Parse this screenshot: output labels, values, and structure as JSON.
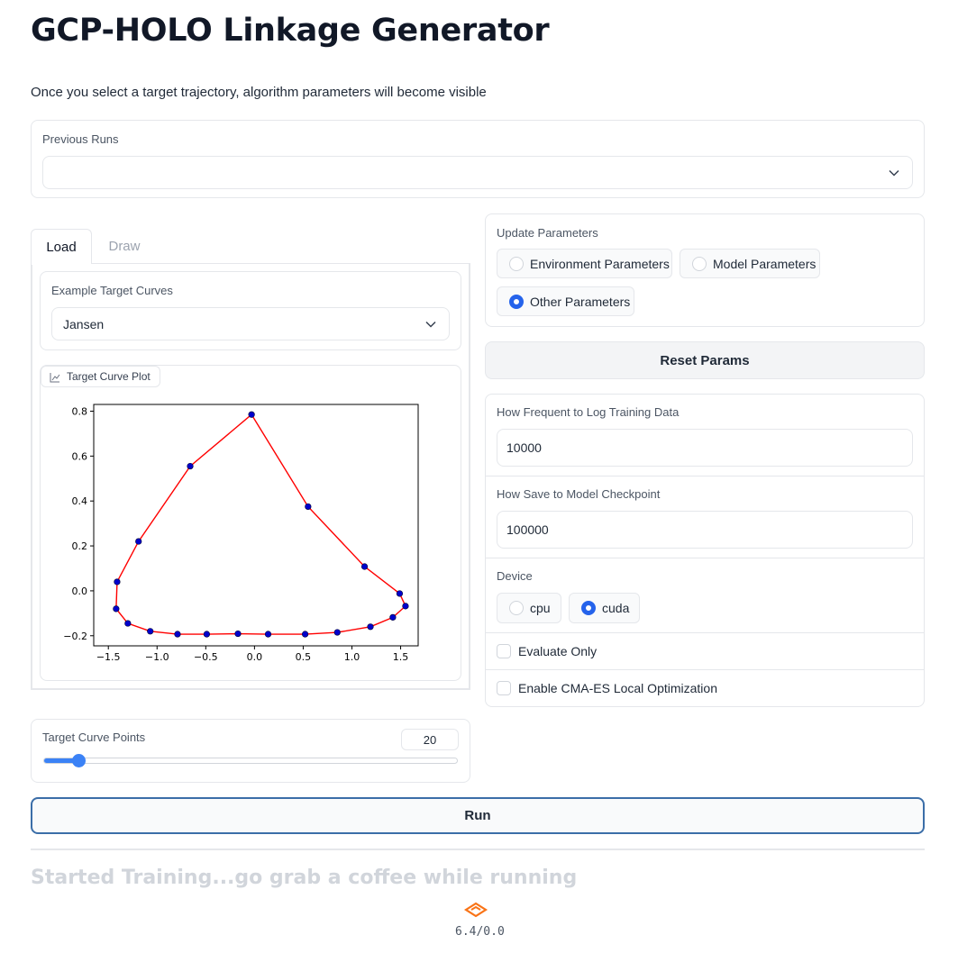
{
  "app": {
    "title": "GCP-HOLO Linkage Generator",
    "subtitle": "Once you select a target trajectory, algorithm parameters will become visible"
  },
  "previous_runs": {
    "label": "Previous Runs",
    "value": ""
  },
  "tabs": [
    {
      "label": "Load",
      "active": true
    },
    {
      "label": "Draw",
      "active": false
    }
  ],
  "example_curves": {
    "label": "Example Target Curves",
    "value": "Jansen"
  },
  "plot": {
    "label": "Target Curve Plot",
    "icon": "chart-icon"
  },
  "chart_data": {
    "type": "line",
    "title": "",
    "xlabel": "",
    "ylabel": "",
    "xlim": [
      -1.65,
      1.68
    ],
    "ylim": [
      -0.245,
      0.83
    ],
    "xticks": [
      -1.5,
      -1.0,
      -0.5,
      0.0,
      0.5,
      1.0,
      1.5
    ],
    "xtick_labels": [
      "−1.5",
      "−1.0",
      "−0.5",
      "0.0",
      "0.5",
      "1.0",
      "1.5"
    ],
    "yticks": [
      -0.2,
      0.0,
      0.2,
      0.4,
      0.6,
      0.8
    ],
    "ytick_labels": [
      "−0.2",
      "0.0",
      "0.2",
      "0.4",
      "0.6",
      "0.8"
    ],
    "grid": false,
    "series": [
      {
        "line_color": "#ff0000",
        "marker_color": "#0000cc",
        "closed": true,
        "x": [
          -0.03,
          0.55,
          1.13,
          1.49,
          1.55,
          1.42,
          1.19,
          0.85,
          0.52,
          0.14,
          -0.17,
          -0.49,
          -0.79,
          -1.07,
          -1.3,
          -1.42,
          -1.41,
          -1.19,
          -0.66
        ],
        "y": [
          0.785,
          0.375,
          0.108,
          -0.012,
          -0.068,
          -0.118,
          -0.16,
          -0.185,
          -0.193,
          -0.193,
          -0.191,
          -0.193,
          -0.193,
          -0.18,
          -0.145,
          -0.08,
          0.04,
          0.22,
          0.555
        ]
      }
    ]
  },
  "update_params": {
    "label": "Update Parameters",
    "options": [
      {
        "label": "Environment Parameters",
        "selected": false
      },
      {
        "label": "Model Parameters",
        "selected": false
      },
      {
        "label": "Other Parameters",
        "selected": true
      }
    ]
  },
  "reset_button": "Reset Params",
  "log_freq": {
    "label": "How Frequent to Log Training Data",
    "value": "10000"
  },
  "checkpoint": {
    "label": "How Save to Model Checkpoint",
    "value": "100000"
  },
  "device": {
    "label": "Device",
    "options": [
      {
        "label": "cpu",
        "selected": false
      },
      {
        "label": "cuda",
        "selected": true
      }
    ]
  },
  "evaluate_only": {
    "label": "Evaluate Only",
    "checked": false
  },
  "cma_es": {
    "label": "Enable CMA-ES Local Optimization",
    "checked": false
  },
  "target_points": {
    "label": "Target Curve Points",
    "value": "20",
    "level": 0.0833
  },
  "run_button": "Run",
  "status": "Started Training...go grab a coffee while running",
  "version": "6.4/0.0",
  "colors": {
    "accent": "#2563eb",
    "slider": "#3b82f6",
    "run_border": "#3b6ea8",
    "status_text": "#d1d5db",
    "logo": "#f97316"
  }
}
